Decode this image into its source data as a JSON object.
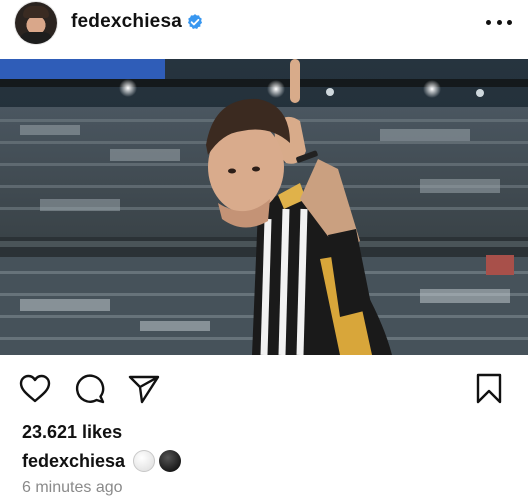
{
  "post": {
    "username": "fedexchiesa",
    "verified": true,
    "likes": "23.621 likes",
    "caption_user": "fedexchiesa",
    "caption_emojis": [
      "white-circle",
      "black-circle"
    ],
    "timestamp": "6 minutes ago"
  },
  "icons": {
    "more": "more-options-icon",
    "like": "heart-icon",
    "comment": "comment-icon",
    "share": "send-icon",
    "save": "bookmark-icon",
    "verified": "verified-badge-icon"
  },
  "colors": {
    "verified_blue": "#3897f0",
    "text": "#111111",
    "muted": "#8a8a8a"
  }
}
